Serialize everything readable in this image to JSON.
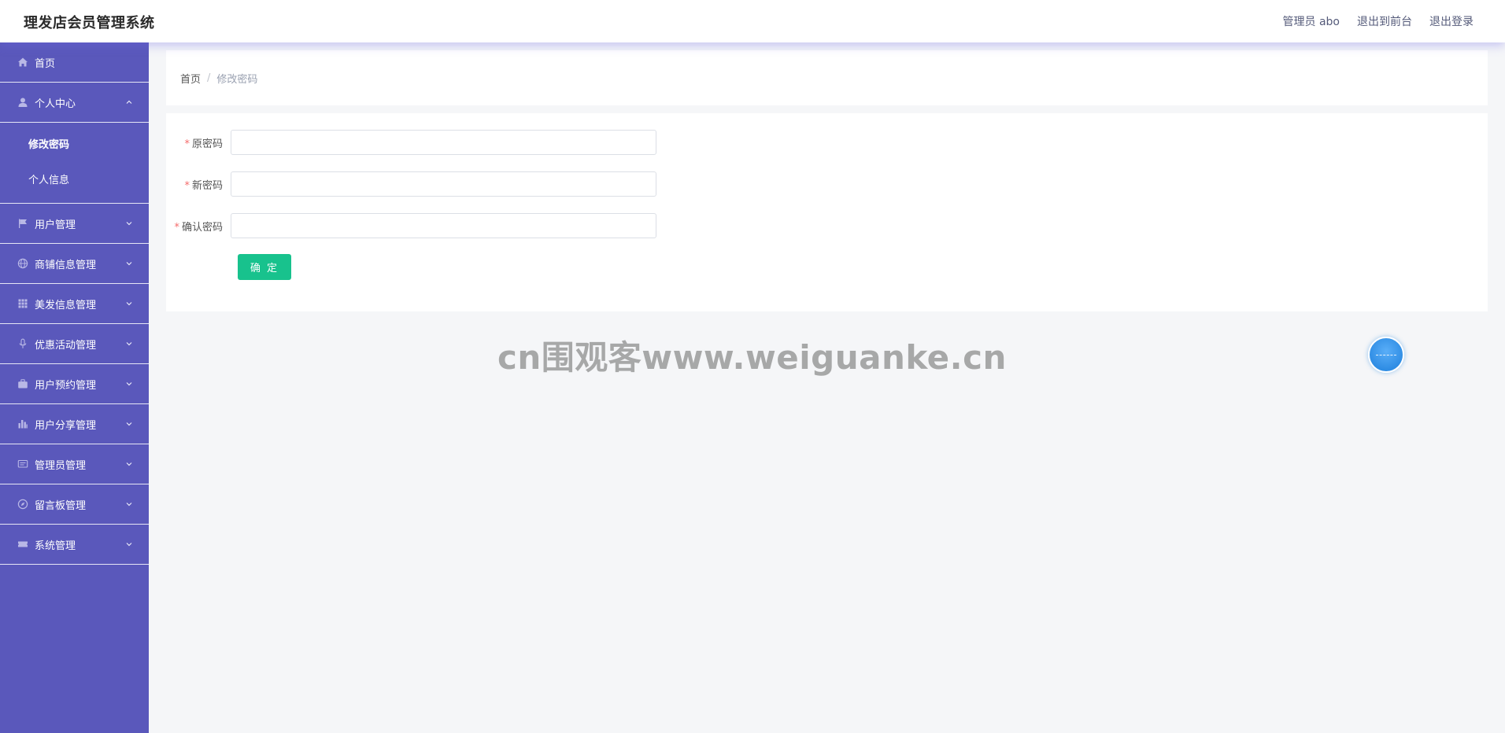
{
  "header": {
    "title": "理发店会员管理系统",
    "admin_label": "管理员 abo",
    "to_front_label": "退出到前台",
    "logout_label": "退出登录"
  },
  "sidebar": {
    "home": {
      "label": "首页",
      "icon": "home-icon"
    },
    "personal_center": {
      "label": "个人中心",
      "icon": "user-icon",
      "expanded": true,
      "children": [
        {
          "label": "修改密码",
          "active": true
        },
        {
          "label": "个人信息",
          "active": false
        }
      ]
    },
    "items": [
      {
        "label": "用户管理",
        "icon": "flag-icon"
      },
      {
        "label": "商铺信息管理",
        "icon": "globe-icon"
      },
      {
        "label": "美发信息管理",
        "icon": "grid-icon"
      },
      {
        "label": "优惠活动管理",
        "icon": "microphone-icon"
      },
      {
        "label": "用户预约管理",
        "icon": "briefcase-icon"
      },
      {
        "label": "用户分享管理",
        "icon": "chart-icon"
      },
      {
        "label": "管理员管理",
        "icon": "message-icon"
      },
      {
        "label": "留言板管理",
        "icon": "compass-icon"
      },
      {
        "label": "系统管理",
        "icon": "ticket-icon"
      }
    ]
  },
  "breadcrumb": {
    "home": "首页",
    "separator": "/",
    "current": "修改密码"
  },
  "form": {
    "required_mark": "*",
    "old_password": {
      "label": "原密码",
      "value": ""
    },
    "new_password": {
      "label": "新密码",
      "value": ""
    },
    "confirm_password": {
      "label": "确认密码",
      "value": ""
    },
    "submit_label": "确 定"
  },
  "watermark": "cn围观客www.weiguanke.cn",
  "colors": {
    "sidebar_bg": "#5a58bb",
    "submit_bg": "#18c28d",
    "required": "#f56c6c"
  }
}
